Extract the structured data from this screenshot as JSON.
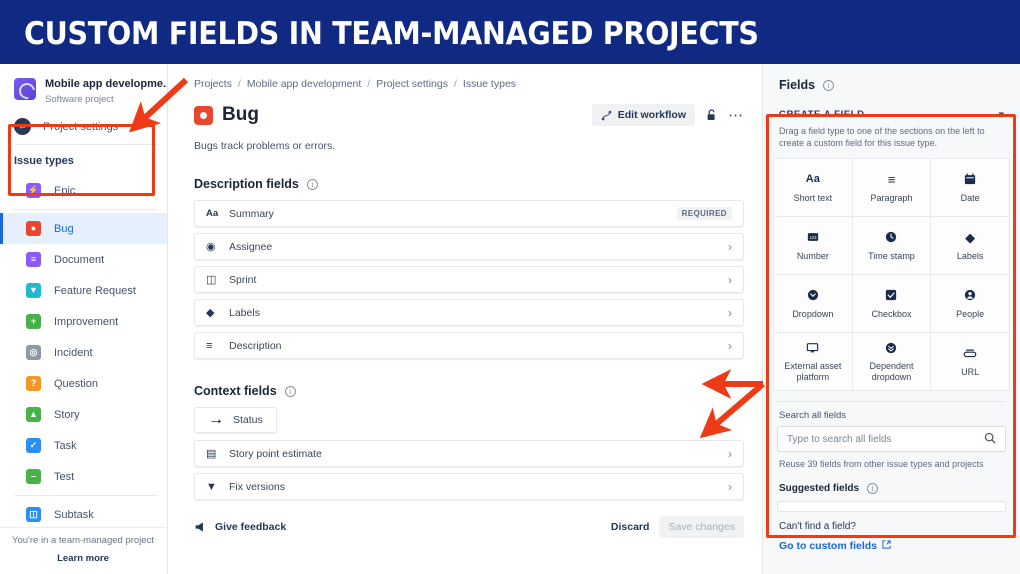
{
  "banner": {
    "title": "CUSTOM FIELDS IN TEAM-MANAGED PROJECTS"
  },
  "sidebar": {
    "project": {
      "name": "Mobile app developme...",
      "subtitle": "Software project"
    },
    "back_item": {
      "label": "Project settings",
      "icon": "back-arrow-icon"
    },
    "section_label": "Issue types",
    "issue_types": [
      {
        "label": "Epic",
        "color": "#8a5cf5",
        "glyph": "⚡"
      },
      {
        "label": "Bug",
        "color": "#e8462f",
        "glyph": "●",
        "selected": true
      },
      {
        "label": "Document",
        "color": "#8a5cf5",
        "glyph": "≡"
      },
      {
        "label": "Feature Request",
        "color": "#22b8cf",
        "glyph": "▼"
      },
      {
        "label": "Improvement",
        "color": "#48b24a",
        "glyph": "+"
      },
      {
        "label": "Incident",
        "color": "#8d98a8",
        "glyph": "◎"
      },
      {
        "label": "Question",
        "color": "#f59427",
        "glyph": "?"
      },
      {
        "label": "Story",
        "color": "#48b24a",
        "glyph": "⚑"
      },
      {
        "label": "Task",
        "color": "#2b8ef0",
        "glyph": "✓"
      },
      {
        "label": "Test",
        "color": "#48b24a",
        "glyph": "–"
      },
      {
        "label": "Subtask",
        "color": "#2b8ef0",
        "glyph": "◳"
      }
    ],
    "footer": {
      "note": "You're in a team-managed project",
      "link": "Learn more"
    }
  },
  "main": {
    "breadcrumb": [
      "Projects",
      "Mobile app development",
      "Project settings",
      "Issue types"
    ],
    "breadcrumb_separator": "/",
    "page_title": "Bug",
    "edit_workflow_label": "Edit workflow",
    "lock_icon": "unlock-icon",
    "more_icon": "more-actions-icon",
    "description": "Bugs track problems or errors.",
    "description_section": {
      "title": "Description fields",
      "fields": [
        {
          "label": "Summary",
          "icon": "Aa",
          "badge": "REQUIRED"
        },
        {
          "label": "Assignee",
          "icon": "◉",
          "chevron": "›"
        },
        {
          "label": "Sprint",
          "icon": "◢",
          "chevron": "›"
        },
        {
          "label": "Labels",
          "icon": "◆",
          "chevron": "›"
        },
        {
          "label": "Description",
          "icon": "≡",
          "chevron": "›"
        }
      ]
    },
    "context_section": {
      "title": "Context fields",
      "status_chip": {
        "label": "Status",
        "icon": "→"
      },
      "fields": [
        {
          "label": "Story point estimate",
          "icon": "▤",
          "chevron": "›"
        },
        {
          "label": "Fix versions",
          "icon": "▼",
          "chevron": "›"
        }
      ]
    },
    "footer": {
      "feedback_label": "Give feedback",
      "discard_label": "Discard",
      "save_label": "Save changes"
    }
  },
  "right_panel": {
    "title": "Fields",
    "create_section": {
      "heading": "CREATE A FIELD",
      "description": "Drag a field type to one of the sections on the left to create a custom field for this issue type.",
      "chevron": "⌄",
      "field_types": [
        {
          "label": "Short text",
          "icon": "Aa"
        },
        {
          "label": "Paragraph",
          "icon": "≡"
        },
        {
          "label": "Date",
          "icon": "Ὄ5"
        },
        {
          "label": "Number",
          "icon": "123"
        },
        {
          "label": "Time stamp",
          "icon": "◔"
        },
        {
          "label": "Labels",
          "icon": "◆"
        },
        {
          "label": "Dropdown",
          "icon": "▼"
        },
        {
          "label": "Checkbox",
          "icon": "☑"
        },
        {
          "label": "People",
          "icon": "◉"
        },
        {
          "label": "External asset platform",
          "icon": "⎕"
        },
        {
          "label": "Dependent dropdown",
          "icon": "▼"
        },
        {
          "label": "URL",
          "icon": "☰"
        }
      ]
    },
    "search": {
      "label": "Search all fields",
      "placeholder": "Type to search all fields",
      "icon": "search-icon",
      "reuse_note": "Reuse 39 fields from other issue types and projects"
    },
    "suggested": {
      "title": "Suggested fields"
    },
    "cant_find": "Can't find a field?",
    "go_to_custom_fields": "Go to custom fields",
    "external_link_icon": "⧉"
  },
  "annotation": {
    "color": "#ee3b17"
  }
}
